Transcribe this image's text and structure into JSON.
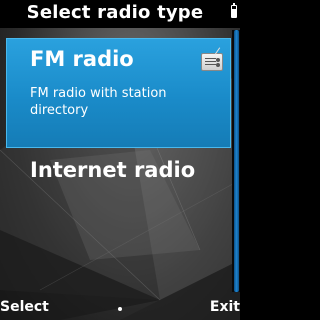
{
  "header": {
    "title": "Select radio type"
  },
  "list": {
    "items": [
      {
        "title": "FM radio",
        "description": "FM radio with station directory",
        "icon": "radio-icon",
        "selected": true
      },
      {
        "title": "Internet radio",
        "selected": false
      }
    ]
  },
  "softkeys": {
    "left": "Select",
    "right": "Exit"
  },
  "colors": {
    "accent": "#1a8bc9",
    "scroll": "#1e84d0"
  }
}
